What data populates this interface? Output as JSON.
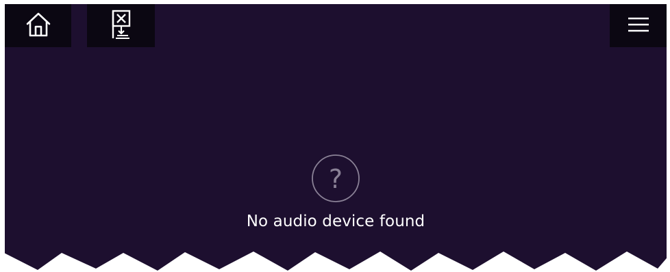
{
  "toolbar": {
    "home_icon": "home-icon",
    "chart_icon": "no-chart-flag-icon",
    "menu_icon": "hamburger-menu-icon",
    "background_color": "#0b0712"
  },
  "main": {
    "background_color": "#1d0f2f",
    "status_icon": "question-circle-icon",
    "status_glyph": "?",
    "message": "No audio device found"
  }
}
